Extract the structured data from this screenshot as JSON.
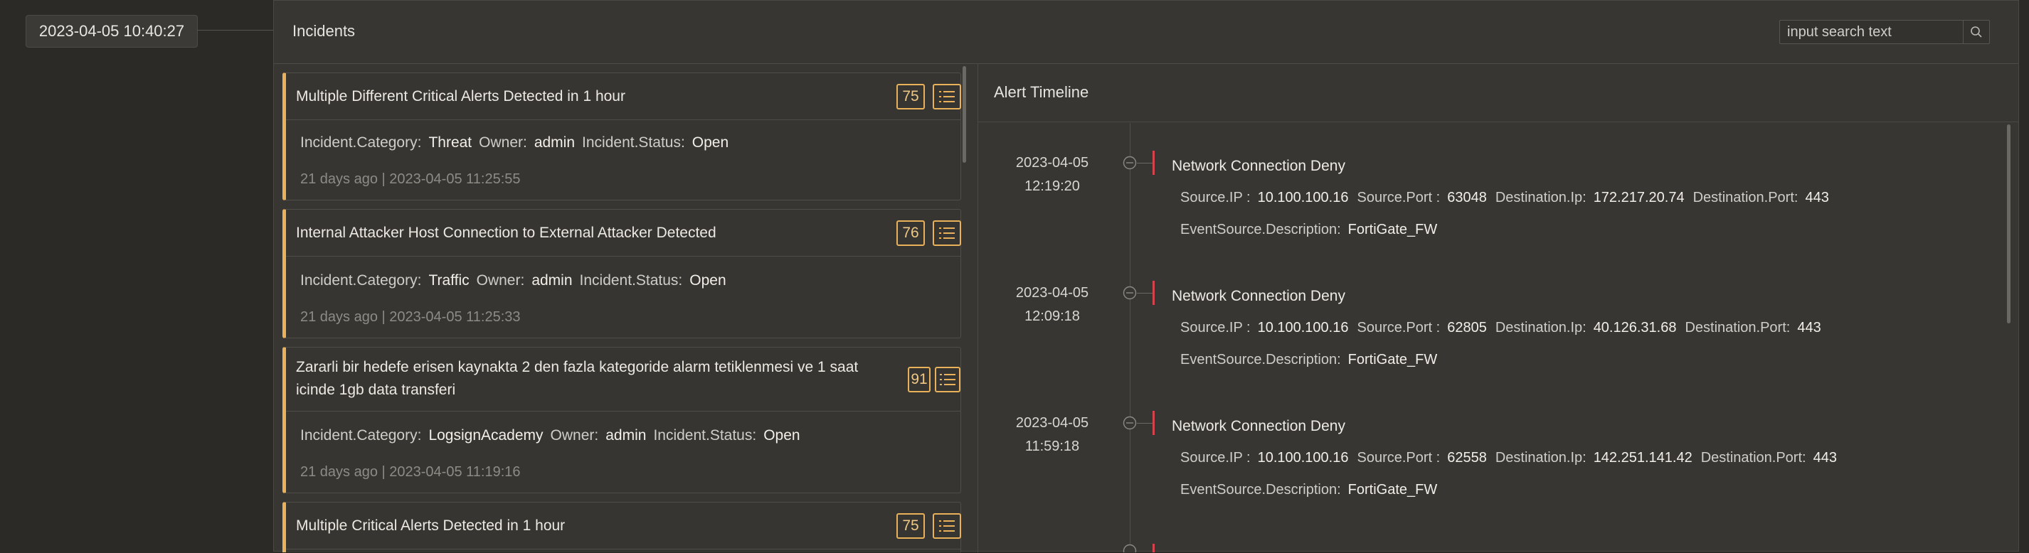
{
  "top_date": "2023-04-05 10:40:27",
  "panel_title": "Incidents",
  "search": {
    "placeholder": "input search text"
  },
  "labels": {
    "category": "Incident.Category:",
    "owner": "Owner:",
    "status": "Incident.Status:",
    "source_ip": "Source.IP :",
    "source_port": "Source.Port :",
    "dest_ip": "Destination.Ip:",
    "dest_port": "Destination.Port:",
    "event_source": "EventSource.Description:"
  },
  "incidents": [
    {
      "title": "Multiple Different Critical Alerts Detected in 1 hour",
      "score": "75",
      "category": "Threat",
      "owner": "admin",
      "status": "Open",
      "time": "21 days ago | 2023-04-05 11:25:55"
    },
    {
      "title": "Internal Attacker Host Connection to External Attacker Detected",
      "score": "76",
      "category": "Traffic",
      "owner": "admin",
      "status": "Open",
      "time": "21 days ago | 2023-04-05 11:25:33"
    },
    {
      "title_line1": "Zararli bir hedefe erisen kaynakta 2 den fazla kategoride alarm tetiklenmesi ve 1 saat",
      "title_line2": "icinde 1gb data transferi",
      "score": "91",
      "category": "LogsignAcademy",
      "owner": "admin",
      "status": "Open",
      "time": "21 days ago | 2023-04-05 11:19:16"
    },
    {
      "title": "Multiple Critical Alerts Detected in 1 hour",
      "score": "75"
    }
  ],
  "timeline": {
    "title": "Alert Timeline",
    "events": [
      {
        "date": "2023-04-05",
        "clock": "12:19:20",
        "title": "Network Connection Deny",
        "source_ip": "10.100.100.16",
        "source_port": "63048",
        "dest_ip": "172.217.20.74",
        "dest_port": "443",
        "event_source": "FortiGate_FW"
      },
      {
        "date": "2023-04-05",
        "clock": "12:09:18",
        "title": "Network Connection Deny",
        "source_ip": "10.100.100.16",
        "source_port": "62805",
        "dest_ip": "40.126.31.68",
        "dest_port": "443",
        "event_source": "FortiGate_FW"
      },
      {
        "date": "2023-04-05",
        "clock": "11:59:18",
        "title": "Network Connection Deny",
        "source_ip": "10.100.100.16",
        "source_port": "62558",
        "dest_ip": "142.251.141.42",
        "dest_port": "443",
        "event_source": "FortiGate_FW"
      }
    ]
  }
}
